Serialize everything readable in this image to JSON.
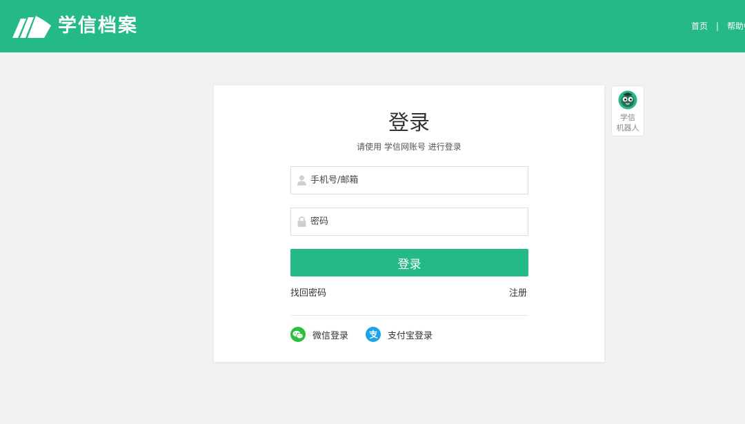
{
  "header": {
    "brand": "学信档案",
    "nav": {
      "home": "首页",
      "separator": "|",
      "help": "帮助中"
    }
  },
  "login": {
    "title": "登录",
    "subtitle": "请使用 学信网账号 进行登录",
    "username_placeholder": "手机号/邮箱",
    "password_placeholder": "密码",
    "submit_label": "登录",
    "forgot_label": "找回密码",
    "register_label": "注册",
    "wechat_label": "微信登录",
    "alipay_label": "支付宝登录"
  },
  "robot": {
    "label_line1": "学信",
    "label_line2": "机器人"
  },
  "colors": {
    "brand": "#24b985",
    "wechat": "#2bbf3e",
    "alipay": "#1aa3e8"
  },
  "icons": {
    "logo": "book-pages-logo",
    "user": "user-icon",
    "lock": "lock-icon",
    "wechat": "wechat-icon",
    "alipay": "alipay-icon",
    "robot": "robot-avatar-icon"
  }
}
